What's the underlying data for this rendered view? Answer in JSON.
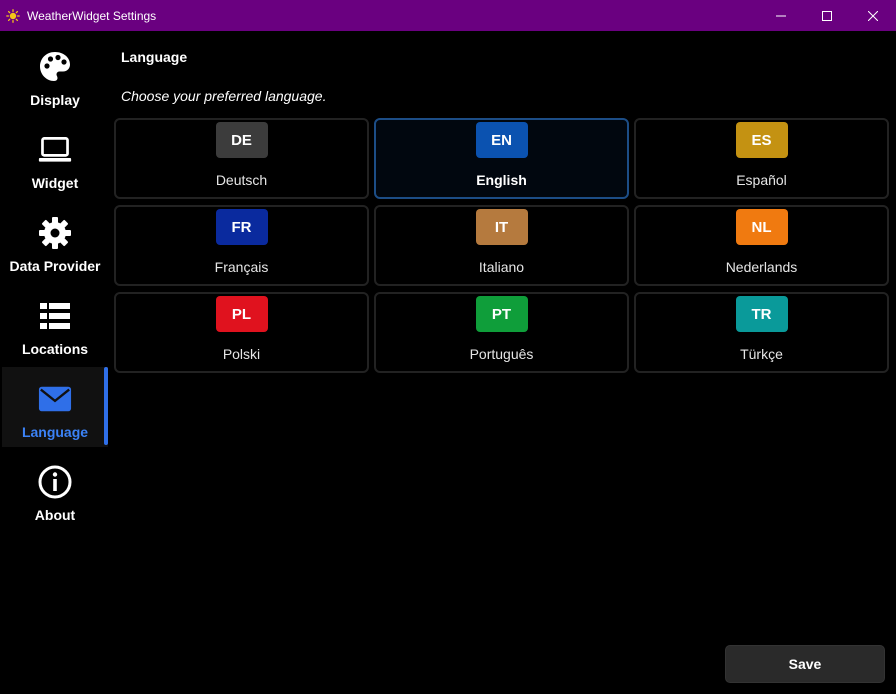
{
  "window": {
    "title": "WeatherWidget Settings",
    "colors": {
      "titlebar": "#6a0080",
      "accent": "#2f6fe8"
    }
  },
  "sidebar": {
    "items": [
      {
        "label": "Display",
        "icon": "palette-icon",
        "active": false
      },
      {
        "label": "Widget",
        "icon": "laptop-icon",
        "active": false
      },
      {
        "label": "Data Provider",
        "icon": "gear-icon",
        "active": false
      },
      {
        "label": "Locations",
        "icon": "list-icon",
        "active": false
      },
      {
        "label": "Language",
        "icon": "mail-icon",
        "active": true
      },
      {
        "label": "About",
        "icon": "info-icon",
        "active": false
      }
    ]
  },
  "main": {
    "title": "Language",
    "subtitle": "Choose your preferred language.",
    "languages": [
      {
        "code": "DE",
        "name": "Deutsch",
        "color": "#3c3c3c",
        "selected": false
      },
      {
        "code": "EN",
        "name": "English",
        "color": "#0b52b0",
        "selected": true
      },
      {
        "code": "ES",
        "name": "Español",
        "color": "#c49212",
        "selected": false
      },
      {
        "code": "FR",
        "name": "Français",
        "color": "#0a2a9e",
        "selected": false
      },
      {
        "code": "IT",
        "name": "Italiano",
        "color": "#b57a3e",
        "selected": false
      },
      {
        "code": "NL",
        "name": "Nederlands",
        "color": "#f07a10",
        "selected": false
      },
      {
        "code": "PL",
        "name": "Polski",
        "color": "#e0121e",
        "selected": false
      },
      {
        "code": "PT",
        "name": "Português",
        "color": "#0f9e3a",
        "selected": false
      },
      {
        "code": "TR",
        "name": "Türkçe",
        "color": "#0a9a9a",
        "selected": false
      }
    ]
  },
  "footer": {
    "save_label": "Save"
  }
}
